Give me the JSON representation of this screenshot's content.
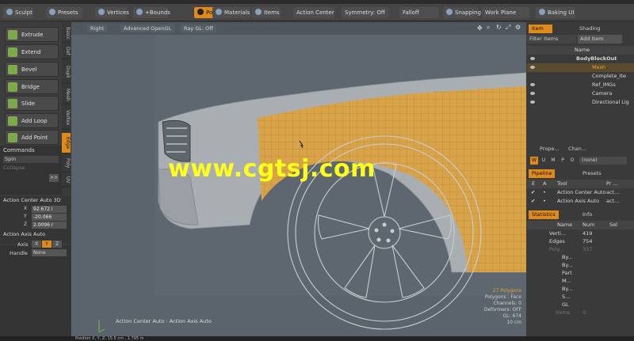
{
  "toolbar": {
    "sculpt": "Sculpt",
    "presets": "Presets",
    "vertices": "Vertices",
    "bounds": "+Bounds",
    "polygons": "Polygons",
    "materials": "Materials",
    "items": "Items",
    "action_center": "Action Center",
    "symmetry": "Symmetry: Off",
    "falloff": "Falloff",
    "snapping": "Snapping",
    "work_plane": "Work Plane",
    "baking_ui": "Baking UI"
  },
  "left_tools": [
    "Extrude",
    "Extend",
    "Bevel",
    "Bridge",
    "Slide",
    "Add Loop",
    "Add Point"
  ],
  "vertical_tabs": [
    "Basic",
    "Def",
    "Dupli",
    "Mesh",
    "Vertex",
    "Edge",
    "Poly",
    "UV"
  ],
  "commands": {
    "title": "Commands",
    "spin": "Spin",
    "collapse": "Collapse",
    "more": ">>"
  },
  "action_center_panel": {
    "title": "Action Center Auto 3D",
    "x_label": "X",
    "x_val": "92.672 i",
    "y_label": "Y",
    "y_val": "-20.066",
    "z_label": "Z",
    "z_val": "2.0096 r"
  },
  "action_axis_panel": {
    "title": "Action Axis Auto",
    "axis_label": "Axis",
    "axis_x": "X",
    "axis_y": "Y",
    "axis_z": "Z",
    "handle_label": "Handle",
    "handle_val": "None"
  },
  "viewport": {
    "view": "Right",
    "shading": "Advanced OpenGL",
    "raygl": "Ray GL: Off",
    "bottom_label": "Action Center Auto : Action Axis Auto",
    "info": [
      "27 Polygons",
      "Polygons : Face",
      "Channels: 0",
      "Deformers: OFF",
      "GL: 674",
      "10 cm"
    ]
  },
  "watermark": "www.cgtsj.com",
  "items_panel": {
    "tab_item": "Item ...",
    "tab_shading": "Shading",
    "filter": "Filter Items",
    "add": "Add Item",
    "col_name": "Name",
    "rows": [
      "BodyBlockOut",
      "Mesh",
      "Complete_Ite",
      "Ref_IMGs",
      "Camera",
      "Directional Lig"
    ]
  },
  "props_tabs": {
    "t1": "Prope...",
    "t2": "Chan..."
  },
  "wumpo": [
    "W",
    "U",
    "M",
    "P",
    "O"
  ],
  "wumpo_none": "(none)",
  "pipeline": {
    "tab1": "Pipeline",
    "tab2": "Presets",
    "col_e": "E",
    "col_a": "A",
    "col_tool": "Tool",
    "col_pr": "Pr ...",
    "rows": [
      {
        "tool": "Action Center Auto",
        "pr": "act..."
      },
      {
        "tool": "Action Axis Auto",
        "pr": "act..."
      }
    ]
  },
  "statistics": {
    "tab1": "Statistics",
    "tab2": "Info",
    "col_name": "Name",
    "col_num": "Num",
    "col_sel": "Sel",
    "rows": [
      {
        "name": "Verti...",
        "num": "419"
      },
      {
        "name": "Edges",
        "num": "754"
      },
      {
        "name": "Poly...",
        "num": "337"
      },
      {
        "name": "By...",
        "num": ""
      },
      {
        "name": "By...",
        "num": ""
      },
      {
        "name": "Part",
        "num": ""
      },
      {
        "name": "M...",
        "num": ""
      },
      {
        "name": "By...",
        "num": ""
      },
      {
        "name": "S...",
        "num": ""
      },
      {
        "name": "GL",
        "num": ""
      },
      {
        "name": "Items",
        "num": "0"
      }
    ]
  },
  "status_bar": "Position X, Y, Z:      15.5 cm , 1.795 m",
  "colors": {
    "accent": "#e08a1a",
    "mesh_grid": "#d4973a",
    "bg": "#5b636c"
  }
}
